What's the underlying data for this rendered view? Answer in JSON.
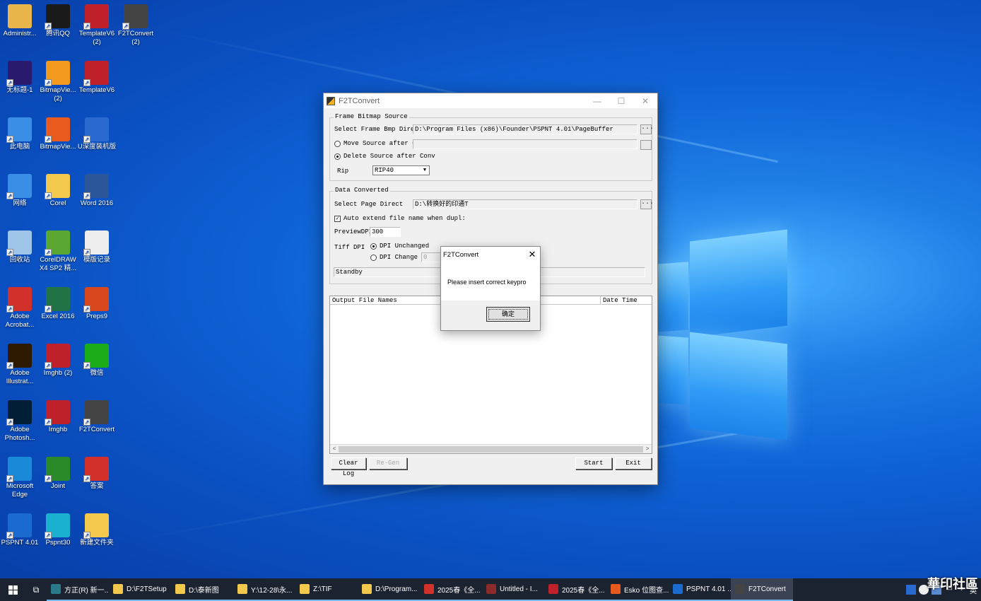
{
  "desktop": {
    "icons": [
      {
        "label": "Administr...",
        "color": "#e8b64a"
      },
      {
        "label": "腾讯QQ",
        "color": "#1a1a1a"
      },
      {
        "label": "TemplateV6 (2)",
        "color": "#c0202a"
      },
      {
        "label": "F2TConvert (2)",
        "color": "#444444"
      },
      {
        "label": "无标题-1",
        "color": "#2a1a6e"
      },
      {
        "label": "BitmapVie... (2)",
        "color": "#f39a1e"
      },
      {
        "label": "TemplateV6",
        "color": "#c0202a"
      },
      {
        "label": "此电脑",
        "color": "#3a8ee6"
      },
      {
        "label": "BitmapVie...",
        "color": "#e85a1e"
      },
      {
        "label": "U深度装机版",
        "color": "#2a6ad0"
      },
      {
        "label": "网络",
        "color": "#3a8ee6"
      },
      {
        "label": "Corel",
        "color": "#f2c94c"
      },
      {
        "label": "Word 2016",
        "color": "#2b579a"
      },
      {
        "label": "回收站",
        "color": "#9fc6e8"
      },
      {
        "label": "CorelDRAW X4 SP2 精...",
        "color": "#5aa832"
      },
      {
        "label": "模版记录",
        "color": "#eeeeee"
      },
      {
        "label": "Adobe Acrobat...",
        "color": "#d2302a"
      },
      {
        "label": "Excel 2016",
        "color": "#217346"
      },
      {
        "label": "Preps9",
        "color": "#d8481e"
      },
      {
        "label": "Adobe Illustrat...",
        "color": "#2d1a00"
      },
      {
        "label": "Imghb (2)",
        "color": "#c0202a"
      },
      {
        "label": "微信",
        "color": "#1aad19"
      },
      {
        "label": "Adobe Photosh...",
        "color": "#001e36"
      },
      {
        "label": "Imghb",
        "color": "#c0202a"
      },
      {
        "label": "F2TConvert",
        "color": "#444444"
      },
      {
        "label": "Microsoft Edge",
        "color": "#1a8ad8"
      },
      {
        "label": "Joint",
        "color": "#2a8a2a"
      },
      {
        "label": "答案",
        "color": "#d2302a"
      },
      {
        "label": "PSPNT 4.01",
        "color": "#1a6ad0"
      },
      {
        "label": "Pspnt30",
        "color": "#1ab0d0"
      },
      {
        "label": "新建文件夹",
        "color": "#f2c94c"
      }
    ]
  },
  "window": {
    "title": "F2TConvert",
    "controls": {
      "minimize": "—",
      "maximize": "☐",
      "close": "✕"
    },
    "frame_group": {
      "legend": "Frame Bitmap Source",
      "select_label": "Select Frame Bmp Director",
      "select_value": "D:\\Program Files (x86)\\Founder\\PSPNT 4.01\\PageBuffer",
      "browse": "...",
      "move_label": "Move Source after Conv",
      "move_value": "",
      "delete_label": "Delete Source after Conv",
      "rip_label": "Rip",
      "rip_value": "RIP40"
    },
    "data_group": {
      "legend": "Data Converted",
      "page_label": "Select Page Direct",
      "page_value": "D:\\转换好的印通T",
      "browse": "...",
      "auto_extend_label": "Auto extend file name when dupl:",
      "preview_label": "PreviewDPI",
      "preview_value": "300",
      "tiff_label": "Tiff DPI",
      "dpi_unchanged": "DPI Unchanged",
      "dpi_change": "DPI Change To",
      "dpi_change_value": "0",
      "status": "Standby"
    },
    "list": {
      "col_output": "Output File Names",
      "col_date": "Date Time"
    },
    "buttons": {
      "clear_log": "Clear Log",
      "regen": "Re-Gen",
      "start": "Start",
      "exit": "Exit"
    }
  },
  "msgbox": {
    "title": "F2TConvert",
    "close": "✕",
    "message": "Please insert correct keypro",
    "ok": "确定"
  },
  "taskbar": {
    "items": [
      {
        "label": "方正(R) 新一...",
        "color": "#2a7a8a"
      },
      {
        "label": "D:\\F2TSetup",
        "color": "#f2c94c"
      },
      {
        "label": "D:\\泰新图",
        "color": "#f2c94c"
      },
      {
        "label": "Y:\\12-28\\永...",
        "color": "#f2c94c"
      },
      {
        "label": "Z:\\TIF",
        "color": "#f2c94c"
      },
      {
        "label": "D:\\Program...",
        "color": "#f2c94c"
      },
      {
        "label": "2025春《全...",
        "color": "#d2302a"
      },
      {
        "label": "Untitled - I...",
        "color": "#8a2a2a"
      },
      {
        "label": "2025春《全...",
        "color": "#c0202a"
      },
      {
        "label": "Esko 位图查...",
        "color": "#e85a1e"
      },
      {
        "label": "PSPNT 4.01 ...",
        "color": "#1a6ad0"
      },
      {
        "label": "F2TConvert",
        "color": "#444444"
      }
    ],
    "ime": "英",
    "watermark": "華印社區"
  }
}
